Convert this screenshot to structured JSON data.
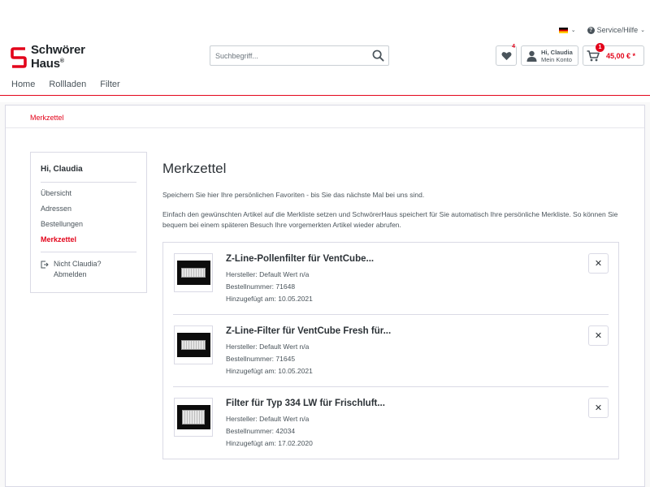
{
  "header": {
    "language_flag": "de",
    "service_label": "Service/Hilfe",
    "logo": {
      "line1": "Schwörer",
      "line2": "Haus",
      "registered": "®",
      "brand_color": "#e3051b"
    },
    "search": {
      "placeholder": "Suchbegriff..."
    },
    "wishlist": {
      "count": "4"
    },
    "account": {
      "greeting": "Hi, Claudia",
      "sub": "Mein Konto"
    },
    "cart": {
      "count": "1",
      "amount": "45,00 € *"
    }
  },
  "nav": {
    "items": [
      "Home",
      "Rollladen",
      "Filter"
    ]
  },
  "breadcrumb": {
    "current": "Merkzettel"
  },
  "sidebar": {
    "greeting": "Hi, Claudia",
    "items": [
      "Übersicht",
      "Adressen",
      "Bestellungen",
      "Merkzettel"
    ],
    "active_index": 3,
    "logout_line1": "Nicht Claudia?",
    "logout_line2": "Abmelden"
  },
  "main": {
    "title": "Merkzettel",
    "intro1": "Speichern Sie hier Ihre persönlichen Favoriten - bis Sie das nächste Mal bei uns sind.",
    "intro2": "Einfach den gewünschten Artikel auf die Merkliste setzen und SchwörerHaus speichert für Sie automatisch Ihre persönliche Merkliste. So können Sie bequem bei einem späteren Besuch Ihre vorgemerkten Artikel wieder abrufen.",
    "items": [
      {
        "title": "Z-Line-Pollenfilter für VentCube...",
        "manufacturer": "Hersteller: Default Wert n/a",
        "order_no": "Bestellnummer: 71648",
        "added": "Hinzugefügt am: 10.05.2021"
      },
      {
        "title": "Z-Line-Filter für VentCube Fresh für...",
        "manufacturer": "Hersteller: Default Wert n/a",
        "order_no": "Bestellnummer: 71645",
        "added": "Hinzugefügt am: 10.05.2021"
      },
      {
        "title": "Filter für Typ 334 LW für Frischluft...",
        "manufacturer": "Hersteller: Default Wert n/a",
        "order_no": "Bestellnummer: 42034",
        "added": "Hinzugefügt am: 17.02.2020"
      }
    ],
    "remove_symbol": "✕"
  },
  "colors": {
    "accent": "#e3051b",
    "text": "#4a545b",
    "border": "#dadae5"
  }
}
